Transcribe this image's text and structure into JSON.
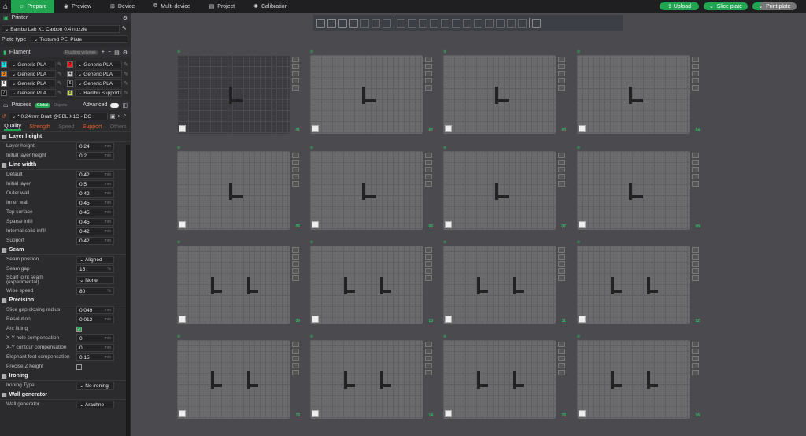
{
  "topbar": {
    "tabs": [
      {
        "label": "Prepare",
        "icon": "prepare-icon"
      },
      {
        "label": "Preview",
        "icon": "preview-icon"
      },
      {
        "label": "Device",
        "icon": "device-icon"
      },
      {
        "label": "Multi-device",
        "icon": "multi-device-icon"
      },
      {
        "label": "Project",
        "icon": "project-icon"
      },
      {
        "label": "Calibration",
        "icon": "calibration-icon"
      }
    ],
    "upload": "Upload",
    "slice": "Slice plate",
    "print": "Print plate"
  },
  "printer": {
    "title": "Printer",
    "name": "Bambu Lab X1 Carbon 0.4 nozzle",
    "plate_type_label": "Plate type",
    "plate_type": "Textured PEI Plate"
  },
  "filament": {
    "title": "Filament",
    "flushing": "Flushing volumes",
    "items": [
      {
        "n": "1",
        "name": "Generic PLA",
        "color": "#1fd8e0"
      },
      {
        "n": "2",
        "name": "Generic PLA",
        "color": "#e62020"
      },
      {
        "n": "3",
        "name": "Generic PLA",
        "color": "#f08a20"
      },
      {
        "n": "4",
        "name": "Generic PLA",
        "color": "#c8c8c8"
      },
      {
        "n": "5",
        "name": "Generic PLA",
        "color": "#ffffff"
      },
      {
        "n": "6",
        "name": "Generic PLA",
        "color": "#111111"
      },
      {
        "n": "7",
        "name": "Generic PLA",
        "color": "#111111"
      },
      {
        "n": "8",
        "name": "Bambu Support Fo...",
        "color": "#c8e060"
      }
    ]
  },
  "process": {
    "title": "Process",
    "global": "Global",
    "objects": "Objects",
    "advanced": "Advanced",
    "preset": "* 0.24mm Draft @BBL X1C - DC",
    "tabs": [
      "Quality",
      "Strength",
      "Speed",
      "Support",
      "Others"
    ]
  },
  "sections": [
    {
      "title": "Layer height",
      "rows": [
        {
          "label": "Layer height",
          "value": "0.24",
          "unit": "mm"
        },
        {
          "label": "Initial layer height",
          "value": "0.2",
          "unit": "mm"
        }
      ]
    },
    {
      "title": "Line width",
      "rows": [
        {
          "label": "Default",
          "value": "0.42",
          "unit": "mm"
        },
        {
          "label": "Initial layer",
          "value": "0.5",
          "unit": "mm"
        },
        {
          "label": "Outer wall",
          "value": "0.42",
          "unit": "mm"
        },
        {
          "label": "Inner wall",
          "value": "0.45",
          "unit": "mm"
        },
        {
          "label": "Top surface",
          "value": "0.45",
          "unit": "mm"
        },
        {
          "label": "Sparse infill",
          "value": "0.45",
          "unit": "mm"
        },
        {
          "label": "Internal solid infill",
          "value": "0.42",
          "unit": "mm"
        },
        {
          "label": "Support",
          "value": "0.42",
          "unit": "mm"
        }
      ]
    },
    {
      "title": "Seam",
      "rows": [
        {
          "label": "Seam position",
          "value": "Aligned",
          "type": "select"
        },
        {
          "label": "Seam gap",
          "value": "15",
          "unit": "%"
        },
        {
          "label": "Scarf joint seam (experimental)",
          "value": "None",
          "type": "select"
        },
        {
          "label": "Wipe speed",
          "value": "80",
          "unit": "%"
        }
      ]
    },
    {
      "title": "Precision",
      "rows": [
        {
          "label": "Slice gap closing radius",
          "value": "0.049",
          "unit": "mm"
        },
        {
          "label": "Resolution",
          "value": "0.012",
          "unit": "mm"
        },
        {
          "label": "Arc fitting",
          "value": "",
          "type": "check",
          "checked": true
        },
        {
          "label": "X-Y hole compensation",
          "value": "0",
          "unit": "mm"
        },
        {
          "label": "X-Y contour compensation",
          "value": "0",
          "unit": "mm"
        },
        {
          "label": "Elephant foot compensation",
          "value": "0.15",
          "unit": "mm"
        },
        {
          "label": "Precise Z height",
          "value": "",
          "type": "check",
          "checked": false
        }
      ]
    },
    {
      "title": "Ironing",
      "rows": [
        {
          "label": "Ironing Type",
          "value": "No ironing",
          "type": "select"
        }
      ]
    },
    {
      "title": "Wall generator",
      "rows": [
        {
          "label": "Wall generator",
          "value": "Arachne",
          "type": "select"
        }
      ]
    }
  ],
  "plates": [
    "01",
    "02",
    "03",
    "04",
    "05",
    "06",
    "07",
    "08",
    "09",
    "10",
    "11",
    "12",
    "13",
    "14",
    "15",
    "16"
  ],
  "selected_plate": "01"
}
